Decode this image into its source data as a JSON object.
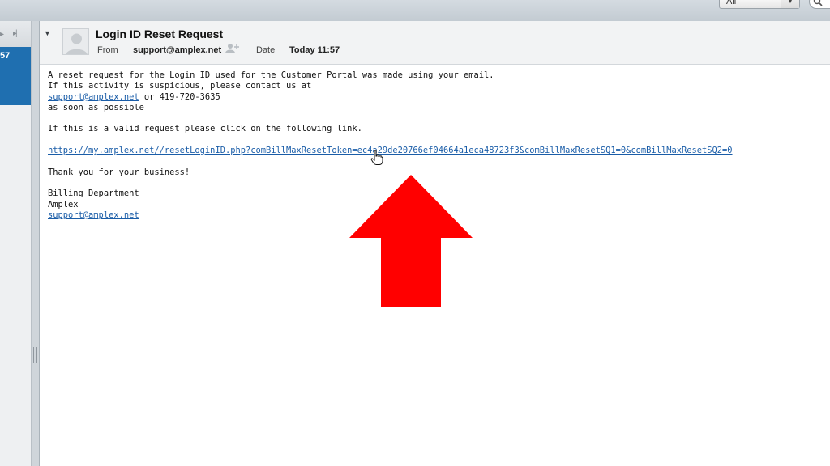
{
  "toolbar": {
    "filter_value": "All"
  },
  "message_list": {
    "selected_time_fragment": "57"
  },
  "message": {
    "subject": "Login ID Reset Request",
    "from_label": "From",
    "sender": "support@amplex.net",
    "date_label": "Date",
    "date_value": "Today 11:57"
  },
  "body": {
    "line1": "A reset request for the Login ID used for the Customer Portal was made using your email.",
    "line2": "If this activity is suspicious, please contact us at",
    "support_email": "support@amplex.net",
    "phone_text": " or 419-720-3635",
    "line4": "as soon as possible",
    "line5": "If this is a valid request please click on the following link.",
    "reset_link": "https://my.amplex.net//resetLoginID.php?comBillMaxResetToken=ec4a29de20766ef04664a1eca48723f3&comBillMaxResetSQ1=0&comBillMaxResetSQ2=0",
    "thanks": "Thank you for your business!",
    "sig_dept": "Billing Department",
    "sig_company": "Amplex",
    "sig_email": "support@amplex.net"
  },
  "annotation": {
    "arrow_color": "#ff0000"
  }
}
